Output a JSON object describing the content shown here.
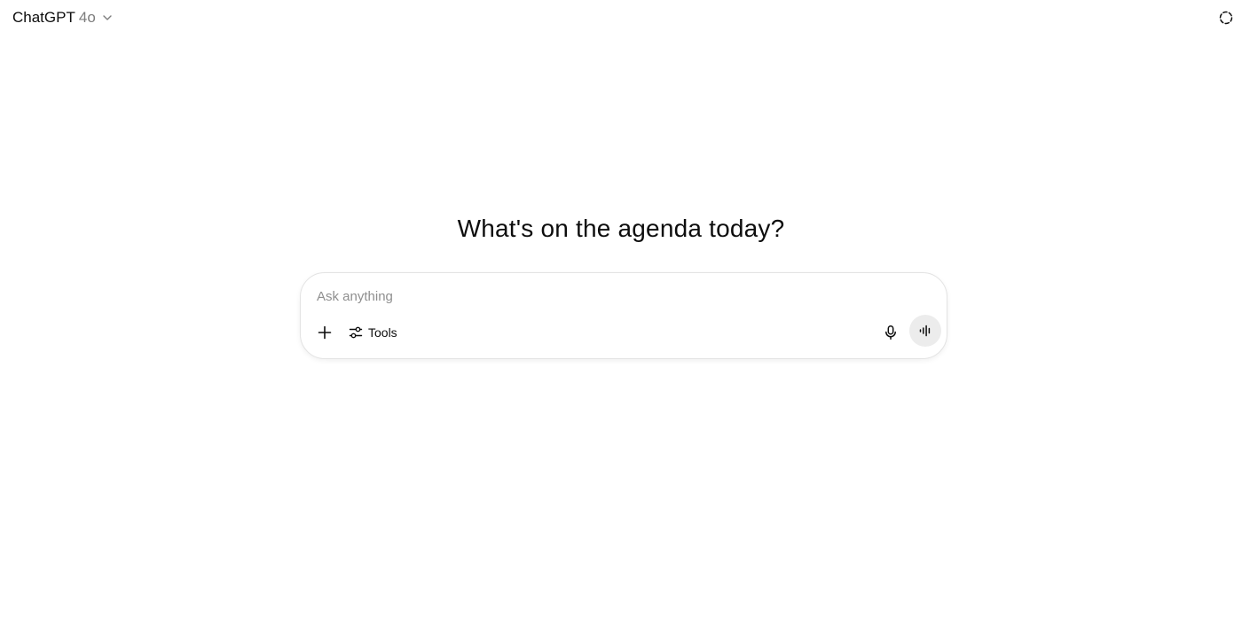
{
  "header": {
    "model_name": "ChatGPT",
    "model_version": "4o",
    "model_dropdown_icon": "chevron-down-icon",
    "temporary_chat_icon": "dashed-circle-icon"
  },
  "main": {
    "headline": "What's on the agenda today?"
  },
  "composer": {
    "placeholder": "Ask anything",
    "value": "",
    "add_icon": "plus-icon",
    "tools_label": "Tools",
    "tools_icon": "sliders-icon",
    "mic_icon": "microphone-icon",
    "voice_icon": "voice-waveform-icon"
  },
  "colors": {
    "text": "#0d0d0d",
    "muted_text": "#7d7d7d",
    "placeholder": "#8f8f8f",
    "border": "#e3e3e3",
    "voice_button_bg": "#ececec",
    "background": "#ffffff"
  }
}
